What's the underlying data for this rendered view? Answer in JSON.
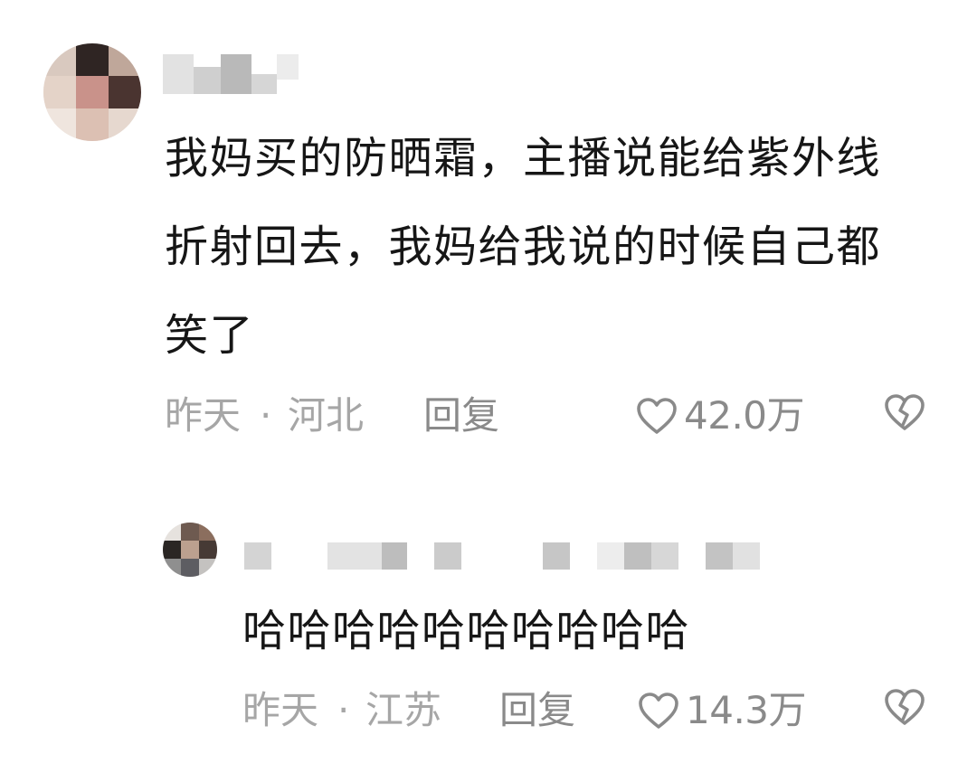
{
  "comments": [
    {
      "text": "我妈买的防晒霜，主播说能给紫外线折射回去，我妈给我说的时候自己都笑了",
      "date": "昨天",
      "separator": "·",
      "location": "河北",
      "reply_label": "回复",
      "likes": "42.0万",
      "icons": [
        "heart-icon",
        "broken-heart-icon"
      ]
    },
    {
      "text": "哈哈哈哈哈哈哈哈哈哈",
      "date": "昨天",
      "separator": "·",
      "location": "江苏",
      "reply_label": "回复",
      "likes": "14.3万",
      "icons": [
        "heart-icon",
        "broken-heart-icon"
      ]
    }
  ],
  "colors": {
    "text": "#161616",
    "meta": "#a6a6a6",
    "icon": "#8a8a8a",
    "background": "#ffffff"
  }
}
